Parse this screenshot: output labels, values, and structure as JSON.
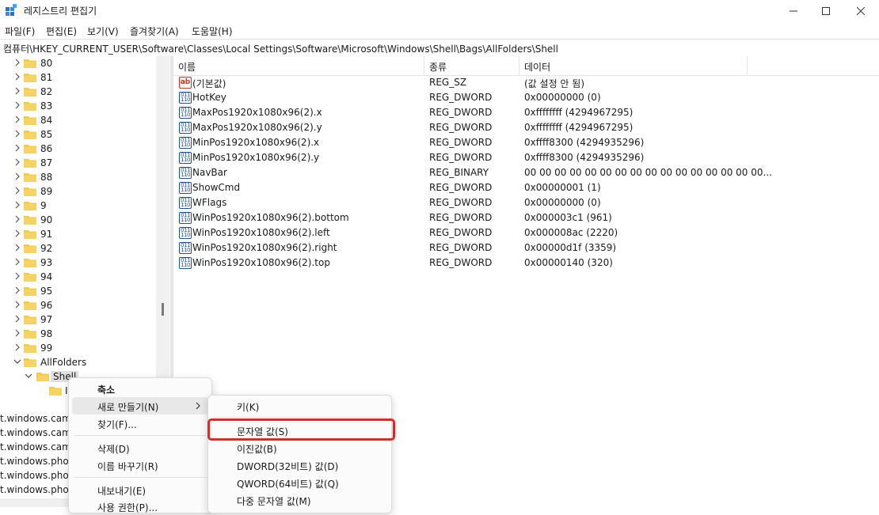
{
  "window": {
    "title": "레지스트리 편집기"
  },
  "menu": [
    "파일(F)",
    "편집(E)",
    "보기(V)",
    "즐겨찾기(A)",
    "도움말(H)"
  ],
  "address": "컴퓨터\\HKEY_CURRENT_USER\\Software\\Classes\\Local Settings\\Software\\Microsoft\\Windows\\Shell\\Bags\\AllFolders\\Shell",
  "tree": {
    "numbered": [
      "80",
      "81",
      "82",
      "83",
      "84",
      "85",
      "86",
      "87",
      "88",
      "89",
      "9",
      "90",
      "91",
      "92",
      "93",
      "94",
      "95",
      "96",
      "97",
      "98",
      "99"
    ],
    "allfolders": "AllFolders",
    "shell": "Shell",
    "child_partial": "I"
  },
  "bottom_items": [
    "t.windows.came",
    "t.windows.came",
    "t.windows.came",
    "t.windows.photo",
    "t.windows.photo",
    "t.windows.photo"
  ],
  "columns": {
    "name": "이름",
    "type": "종류",
    "data": "데이터"
  },
  "values": [
    {
      "icon": "string-value-icon",
      "name": "(기본값)",
      "type": "REG_SZ",
      "data": "(값 설정 안 됨)"
    },
    {
      "icon": "binary-value-icon",
      "name": "HotKey",
      "type": "REG_DWORD",
      "data": "0x00000000 (0)"
    },
    {
      "icon": "binary-value-icon",
      "name": "MaxPos1920x1080x96(2).x",
      "type": "REG_DWORD",
      "data": "0xffffffff (4294967295)"
    },
    {
      "icon": "binary-value-icon",
      "name": "MaxPos1920x1080x96(2).y",
      "type": "REG_DWORD",
      "data": "0xffffffff (4294967295)"
    },
    {
      "icon": "binary-value-icon",
      "name": "MinPos1920x1080x96(2).x",
      "type": "REG_DWORD",
      "data": "0xffff8300 (4294935296)"
    },
    {
      "icon": "binary-value-icon",
      "name": "MinPos1920x1080x96(2).y",
      "type": "REG_DWORD",
      "data": "0xffff8300 (4294935296)"
    },
    {
      "icon": "binary-value-icon",
      "name": "NavBar",
      "type": "REG_BINARY",
      "data": "00 00 00 00 00 00 00 00 00 00 00 00 00 00 00 00..."
    },
    {
      "icon": "binary-value-icon",
      "name": "ShowCmd",
      "type": "REG_DWORD",
      "data": "0x00000001 (1)"
    },
    {
      "icon": "binary-value-icon",
      "name": "WFlags",
      "type": "REG_DWORD",
      "data": "0x00000000 (0)"
    },
    {
      "icon": "binary-value-icon",
      "name": "WinPos1920x1080x96(2).bottom",
      "type": "REG_DWORD",
      "data": "0x000003c1 (961)"
    },
    {
      "icon": "binary-value-icon",
      "name": "WinPos1920x1080x96(2).left",
      "type": "REG_DWORD",
      "data": "0x000008ac (2220)"
    },
    {
      "icon": "binary-value-icon",
      "name": "WinPos1920x1080x96(2).right",
      "type": "REG_DWORD",
      "data": "0x00000d1f (3359)"
    },
    {
      "icon": "binary-value-icon",
      "name": "WinPos1920x1080x96(2).top",
      "type": "REG_DWORD",
      "data": "0x00000140 (320)"
    }
  ],
  "context_menu": {
    "collapse": "축소",
    "new": "새로 만들기(N)",
    "find": "찾기(F)...",
    "delete": "삭제(D)",
    "rename": "이름 바꾸기(R)",
    "export": "내보내기(E)",
    "permissions": "사용 권한(P)..."
  },
  "submenu": {
    "key": "키(K)",
    "string_value": "문자열 값(S)",
    "binary_value": "이진값(B)",
    "dword_value": "DWORD(32비트) 값(D)",
    "qword_value": "QWORD(64비트) 값(Q)",
    "multi_string_value": "다중 문자열 값(M)"
  },
  "colors": {
    "folder": "#f2c94c",
    "highlight": "#d12f2f",
    "accent": "#0067c0"
  }
}
